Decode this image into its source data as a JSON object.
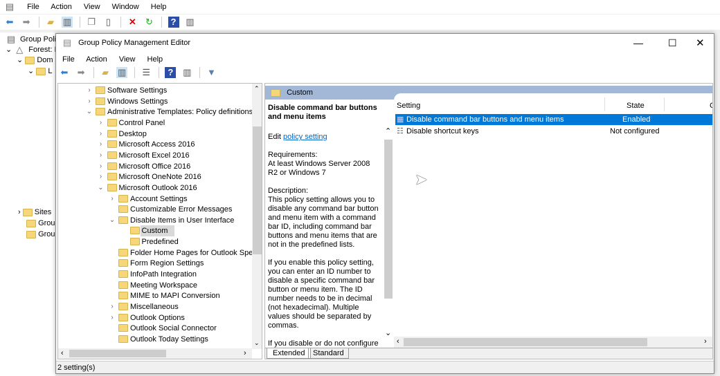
{
  "outer": {
    "menu": [
      "File",
      "Action",
      "View",
      "Window",
      "Help"
    ],
    "tree": [
      {
        "label": "Group Policy"
      },
      {
        "label": "Forest: L"
      },
      {
        "label": "Dom"
      },
      {
        "label": "L"
      },
      {
        "label": "Sites"
      },
      {
        "label": "Grou"
      },
      {
        "label": "Grou"
      }
    ]
  },
  "editor": {
    "title": "Group Policy Management Editor",
    "menu": [
      "File",
      "Action",
      "View",
      "Help"
    ],
    "tree": [
      {
        "label": "Software Settings",
        "level": 0,
        "exp": ">"
      },
      {
        "label": "Windows Settings",
        "level": 0,
        "exp": ">"
      },
      {
        "label": "Administrative Templates: Policy definitions (A",
        "level": 0,
        "exp": "v"
      },
      {
        "label": "Control Panel",
        "level": 1,
        "exp": ">"
      },
      {
        "label": "Desktop",
        "level": 1,
        "exp": ">"
      },
      {
        "label": "Microsoft Access 2016",
        "level": 1,
        "exp": ">"
      },
      {
        "label": "Microsoft Excel 2016",
        "level": 1,
        "exp": ">"
      },
      {
        "label": "Microsoft Office 2016",
        "level": 1,
        "exp": ">"
      },
      {
        "label": "Microsoft OneNote 2016",
        "level": 1,
        "exp": ">"
      },
      {
        "label": "Microsoft Outlook 2016",
        "level": 1,
        "exp": "v"
      },
      {
        "label": "Account Settings",
        "level": 2,
        "exp": ">"
      },
      {
        "label": "Customizable Error Messages",
        "level": 2,
        "exp": ""
      },
      {
        "label": "Disable Items in User Interface",
        "level": 2,
        "exp": "v"
      },
      {
        "label": "Custom",
        "level": 3,
        "exp": "",
        "selected": true
      },
      {
        "label": "Predefined",
        "level": 3,
        "exp": ""
      },
      {
        "label": "Folder Home Pages for Outlook Special",
        "level": 2,
        "exp": ""
      },
      {
        "label": "Form Region Settings",
        "level": 2,
        "exp": ""
      },
      {
        "label": "InfoPath Integration",
        "level": 2,
        "exp": ""
      },
      {
        "label": "Meeting Workspace",
        "level": 2,
        "exp": ""
      },
      {
        "label": "MIME to MAPI Conversion",
        "level": 2,
        "exp": ""
      },
      {
        "label": "Miscellaneous",
        "level": 2,
        "exp": ">"
      },
      {
        "label": "Outlook Options",
        "level": 2,
        "exp": ">"
      },
      {
        "label": "Outlook Social Connector",
        "level": 2,
        "exp": ""
      },
      {
        "label": "Outlook Today Settings",
        "level": 2,
        "exp": ""
      }
    ],
    "header": "Custom",
    "desc": {
      "title": "Disable command bar buttons and menu items",
      "edit": "Edit",
      "edit_link": "policy setting",
      "requirements": "Requirements:\nAt least Windows Server 2008 R2 or Windows 7",
      "description": "Description:\nThis policy setting allows you to disable any command bar button and menu item with a command bar ID, including command bar buttons and menu items that are not in the predefined lists.",
      "enable": "If you enable this policy setting, you can enter an ID number to disable a specific command bar button or menu item.  The ID number needs to be in decimal (not hexadecimal).  Multiple values should be separated by commas.",
      "disable": "If you disable or do not configure"
    },
    "columns": {
      "setting": "Setting",
      "state": "State",
      "comment": "C"
    },
    "rows": [
      {
        "setting": "Disable command bar buttons and menu items",
        "state": "Enabled"
      },
      {
        "setting": "Disable shortcut keys",
        "state": "Not configured"
      }
    ],
    "tabs": [
      "Extended",
      "Standard"
    ],
    "status": "2 setting(s)",
    "colors": {
      "selection": "#0078d7",
      "header": "#a3b8d7"
    }
  }
}
